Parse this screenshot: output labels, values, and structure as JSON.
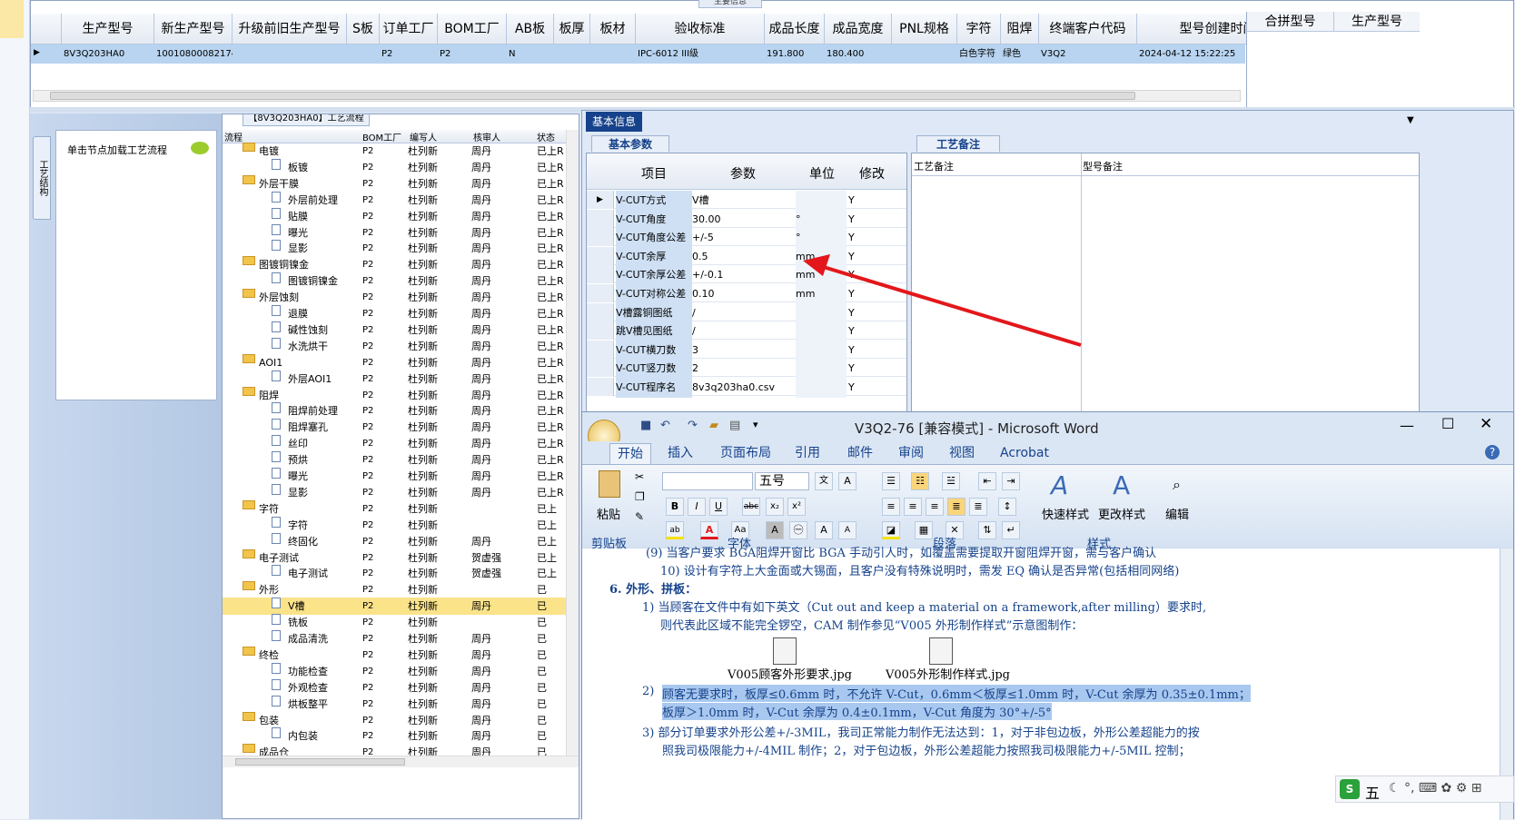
{
  "top": {
    "header_label": "主要信息",
    "columns": [
      "生产型号",
      "新生产型号",
      "升级前旧生产型号",
      "S板",
      "订单工厂",
      "BOM工厂",
      "AB板",
      "板厚",
      "板材",
      "验收标准",
      "成品长度",
      "成品宽度",
      "PNL规格",
      "字符",
      "阻焊",
      "终端客户代码",
      "型号创建时间"
    ],
    "row": {
      "生产型号": "8V3Q203HA0",
      "新生产型号": "10010800082174",
      "订单工厂": "P2",
      "BOM工厂": "P2",
      "AB板": "N",
      "验收标准": "IPC-6012 III级",
      "成品长度": "191.800",
      "成品宽度": "180.400",
      "字符": "白色字符",
      "阻焊": "绿色",
      "终端客户代码": "V3Q2",
      "型号创建时间": "2024-04-12 15:22:25"
    },
    "right_columns": [
      "合拼型号",
      "生产型号"
    ]
  },
  "left": {
    "vertical_tab": "工艺结构",
    "node_hint": "单击节点加载工艺流程"
  },
  "process": {
    "title": "【8V3Q203HA0】工艺流程",
    "columns": [
      "流程",
      "BOM工厂",
      "编写人",
      "核审人",
      "状态"
    ],
    "rows": [
      {
        "name": "电镀",
        "level": 0,
        "bom": "P2",
        "writer": "杜列新",
        "reviewer": "周丹",
        "status": "已上R"
      },
      {
        "name": "板镀",
        "level": 1,
        "bom": "P2",
        "writer": "杜列新",
        "reviewer": "周丹",
        "status": "已上R"
      },
      {
        "name": "外层干膜",
        "level": 0,
        "bom": "P2",
        "writer": "杜列新",
        "reviewer": "周丹",
        "status": "已上R"
      },
      {
        "name": "外层前处理",
        "level": 1,
        "bom": "P2",
        "writer": "杜列新",
        "reviewer": "周丹",
        "status": "已上R"
      },
      {
        "name": "贴膜",
        "level": 1,
        "bom": "P2",
        "writer": "杜列新",
        "reviewer": "周丹",
        "status": "已上R"
      },
      {
        "name": "曝光",
        "level": 1,
        "bom": "P2",
        "writer": "杜列新",
        "reviewer": "周丹",
        "status": "已上R"
      },
      {
        "name": "显影",
        "level": 1,
        "bom": "P2",
        "writer": "杜列新",
        "reviewer": "周丹",
        "status": "已上R"
      },
      {
        "name": "图镀铜镍金",
        "level": 0,
        "bom": "P2",
        "writer": "杜列新",
        "reviewer": "周丹",
        "status": "已上R"
      },
      {
        "name": "图镀铜镍金",
        "level": 1,
        "bom": "P2",
        "writer": "杜列新",
        "reviewer": "周丹",
        "status": "已上R"
      },
      {
        "name": "外层蚀刻",
        "level": 0,
        "bom": "P2",
        "writer": "杜列新",
        "reviewer": "周丹",
        "status": "已上R"
      },
      {
        "name": "退膜",
        "level": 1,
        "bom": "P2",
        "writer": "杜列新",
        "reviewer": "周丹",
        "status": "已上R"
      },
      {
        "name": "碱性蚀刻",
        "level": 1,
        "bom": "P2",
        "writer": "杜列新",
        "reviewer": "周丹",
        "status": "已上R"
      },
      {
        "name": "水洗烘干",
        "level": 1,
        "bom": "P2",
        "writer": "杜列新",
        "reviewer": "周丹",
        "status": "已上R"
      },
      {
        "name": "AOI1",
        "level": 0,
        "bom": "P2",
        "writer": "杜列新",
        "reviewer": "周丹",
        "status": "已上R"
      },
      {
        "name": "外层AOI1",
        "level": 1,
        "bom": "P2",
        "writer": "杜列新",
        "reviewer": "周丹",
        "status": "已上R"
      },
      {
        "name": "阻焊",
        "level": 0,
        "bom": "P2",
        "writer": "杜列新",
        "reviewer": "周丹",
        "status": "已上R"
      },
      {
        "name": "阻焊前处理",
        "level": 1,
        "bom": "P2",
        "writer": "杜列新",
        "reviewer": "周丹",
        "status": "已上R"
      },
      {
        "name": "阻焊塞孔",
        "level": 1,
        "bom": "P2",
        "writer": "杜列新",
        "reviewer": "周丹",
        "status": "已上R"
      },
      {
        "name": "丝印",
        "level": 1,
        "bom": "P2",
        "writer": "杜列新",
        "reviewer": "周丹",
        "status": "已上R"
      },
      {
        "name": "预烘",
        "level": 1,
        "bom": "P2",
        "writer": "杜列新",
        "reviewer": "周丹",
        "status": "已上R"
      },
      {
        "name": "曝光",
        "level": 1,
        "bom": "P2",
        "writer": "杜列新",
        "reviewer": "周丹",
        "status": "已上R"
      },
      {
        "name": "显影",
        "level": 1,
        "bom": "P2",
        "writer": "杜列新",
        "reviewer": "周丹",
        "status": "已上R"
      },
      {
        "name": "字符",
        "level": 0,
        "bom": "P2",
        "writer": "杜列新",
        "reviewer": "",
        "status": "已上"
      },
      {
        "name": "字符",
        "level": 1,
        "bom": "P2",
        "writer": "杜列新",
        "reviewer": "",
        "status": "已上"
      },
      {
        "name": "终固化",
        "level": 1,
        "bom": "P2",
        "writer": "杜列新",
        "reviewer": "周丹",
        "status": "已上"
      },
      {
        "name": "电子测试",
        "level": 0,
        "bom": "P2",
        "writer": "杜列新",
        "reviewer": "贺虚强",
        "status": "已上"
      },
      {
        "name": "电子测试",
        "level": 1,
        "bom": "P2",
        "writer": "杜列新",
        "reviewer": "贺虚强",
        "status": "已上"
      },
      {
        "name": "外形",
        "level": 0,
        "bom": "P2",
        "writer": "杜列新",
        "reviewer": "",
        "status": "已"
      },
      {
        "name": "V槽",
        "level": 1,
        "bom": "P2",
        "writer": "杜列新",
        "reviewer": "周丹",
        "status": "已",
        "selected": true
      },
      {
        "name": "铣板",
        "level": 1,
        "bom": "P2",
        "writer": "杜列新",
        "reviewer": "",
        "status": "已"
      },
      {
        "name": "成品清洗",
        "level": 1,
        "bom": "P2",
        "writer": "杜列新",
        "reviewer": "周丹",
        "status": "已"
      },
      {
        "name": "终检",
        "level": 0,
        "bom": "P2",
        "writer": "杜列新",
        "reviewer": "周丹",
        "status": "已"
      },
      {
        "name": "功能检查",
        "level": 1,
        "bom": "P2",
        "writer": "杜列新",
        "reviewer": "周丹",
        "status": "已"
      },
      {
        "name": "外观检查",
        "level": 1,
        "bom": "P2",
        "writer": "杜列新",
        "reviewer": "周丹",
        "status": "已"
      },
      {
        "name": "烘板整平",
        "level": 1,
        "bom": "P2",
        "writer": "杜列新",
        "reviewer": "周丹",
        "status": "已"
      },
      {
        "name": "包装",
        "level": 0,
        "bom": "P2",
        "writer": "杜列新",
        "reviewer": "周丹",
        "status": "已"
      },
      {
        "name": "内包装",
        "level": 1,
        "bom": "P2",
        "writer": "杜列新",
        "reviewer": "周丹",
        "status": "已"
      },
      {
        "name": "成品仓",
        "level": 0,
        "bom": "P2",
        "writer": "杜列新",
        "reviewer": "周丹",
        "status": "已"
      }
    ]
  },
  "basic": {
    "tab": "基本信息",
    "subtab": "基本参数",
    "columns": [
      "项目",
      "参数",
      "单位",
      "修改"
    ],
    "rows": [
      {
        "item": "V-CUT方式",
        "param": "V槽",
        "unit": "",
        "mod": "Y"
      },
      {
        "item": "V-CUT角度",
        "param": "30.00",
        "unit": "°",
        "mod": "Y"
      },
      {
        "item": "V-CUT角度公差",
        "param": "+/-5",
        "unit": "°",
        "mod": "Y"
      },
      {
        "item": "V-CUT余厚",
        "param": "0.5",
        "unit": "mm",
        "mod": "Y"
      },
      {
        "item": "V-CUT余厚公差",
        "param": "+/-0.1",
        "unit": "mm",
        "mod": "Y"
      },
      {
        "item": "V-CUT对称公差",
        "param": "0.10",
        "unit": "mm",
        "mod": "Y"
      },
      {
        "item": "V槽露铜图纸",
        "param": "/",
        "unit": "",
        "mod": "Y"
      },
      {
        "item": "跳V槽见图纸",
        "param": "/",
        "unit": "",
        "mod": "Y"
      },
      {
        "item": "V-CUT横刀数",
        "param": "3",
        "unit": "",
        "mod": "Y"
      },
      {
        "item": "V-CUT竖刀数",
        "param": "2",
        "unit": "",
        "mod": "Y"
      },
      {
        "item": "V-CUT程序名",
        "param": "8v3q203ha0.csv",
        "unit": "",
        "mod": "Y"
      }
    ],
    "notes_tab": "工艺备注",
    "notes_cols": [
      "工艺备注",
      "型号备注"
    ]
  },
  "word": {
    "title": "V3Q2-76 [兼容模式] - Microsoft Word",
    "tabs": [
      "开始",
      "插入",
      "页面布局",
      "引用",
      "邮件",
      "审阅",
      "视图",
      "Acrobat"
    ],
    "font_size": "五号",
    "groups": {
      "clipboard": "剪贴板",
      "font": "字体",
      "paragraph": "段落",
      "styles": "样式",
      "edit_group": "编辑"
    },
    "paste": "粘贴",
    "quick_style": "快速样式",
    "change_style": "更改样式",
    "edit": "编辑",
    "lines": [
      "(9) 当客户要求 BGA阻焊开窗比 BGA 手动引人时，如覆盖需要提取开窗阻焊开窗，需与客户确认",
      "10) 设计有字符上大金面或大锡面，且客户没有特殊说明时，需发 EQ 确认是否异常(包括相同网络)",
      "6.  外形、拼板：",
      "1) 当顾客在文件中有如下英文（Cut out and keep a material on a framework,after milling）要求时,",
      "则代表此区域不能完全锣空，CAM 制作参见“V005 外形制作样式”示意图制作：",
      "V005顾客外形要求.jpg",
      "V005外形制作样式.jpg",
      "2)",
      "顾客无要求时，板厚≤0.6mm 时，不允许 V-Cut，0.6mm＜板厚≤1.0mm 时，V-Cut 余厚为 0.35±0.1mm；",
      "板厚＞1.0mm 时，V-Cut 余厚为 0.4±0.1mm，V-Cut 角度为 30°+/-5°",
      "3) 部分订单要求外形公差+/-3MIL，我司正常能力制作无法达到：1，对于非包边板，外形公差超能力的按",
      "照我司极限能力+/-4MIL 制作；2，对于包边板，外形公差超能力按照我司极限能力+/-5MIL 控制；"
    ]
  },
  "ime": {
    "label": "五"
  }
}
